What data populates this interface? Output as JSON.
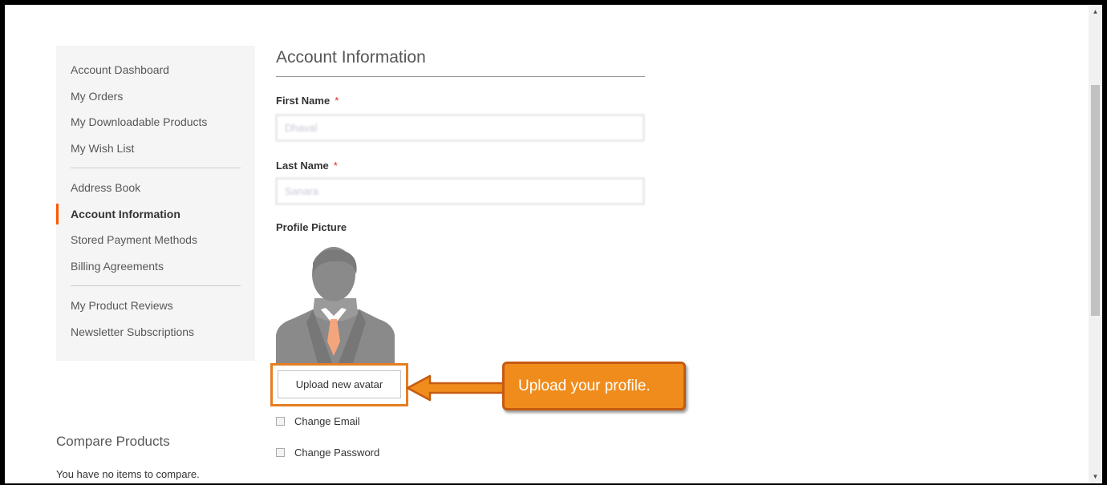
{
  "sidebar": {
    "groups": [
      [
        "Account Dashboard",
        "My Orders",
        "My Downloadable Products",
        "My Wish List"
      ],
      [
        "Address Book",
        "Account Information",
        "Stored Payment Methods",
        "Billing Agreements"
      ],
      [
        "My Product Reviews",
        "Newsletter Subscriptions"
      ]
    ],
    "active": "Account Information"
  },
  "compare": {
    "title": "Compare Products",
    "empty_text": "You have no items to compare."
  },
  "main": {
    "title": "Account Information",
    "first_name": {
      "label": "First Name",
      "required": "*",
      "value": "Dhaval"
    },
    "last_name": {
      "label": "Last Name",
      "required": "*",
      "value": "Sanara"
    },
    "profile_picture_label": "Profile Picture",
    "upload_button": "Upload new avatar",
    "change_email": "Change Email",
    "change_password": "Change Password"
  },
  "annotation": {
    "callout_text": "Upload your profile.",
    "color": "#f08c1c"
  },
  "icons": [
    "avatar-placeholder-icon",
    "arrow-left-icon",
    "scroll-up-icon",
    "scroll-down-icon"
  ]
}
